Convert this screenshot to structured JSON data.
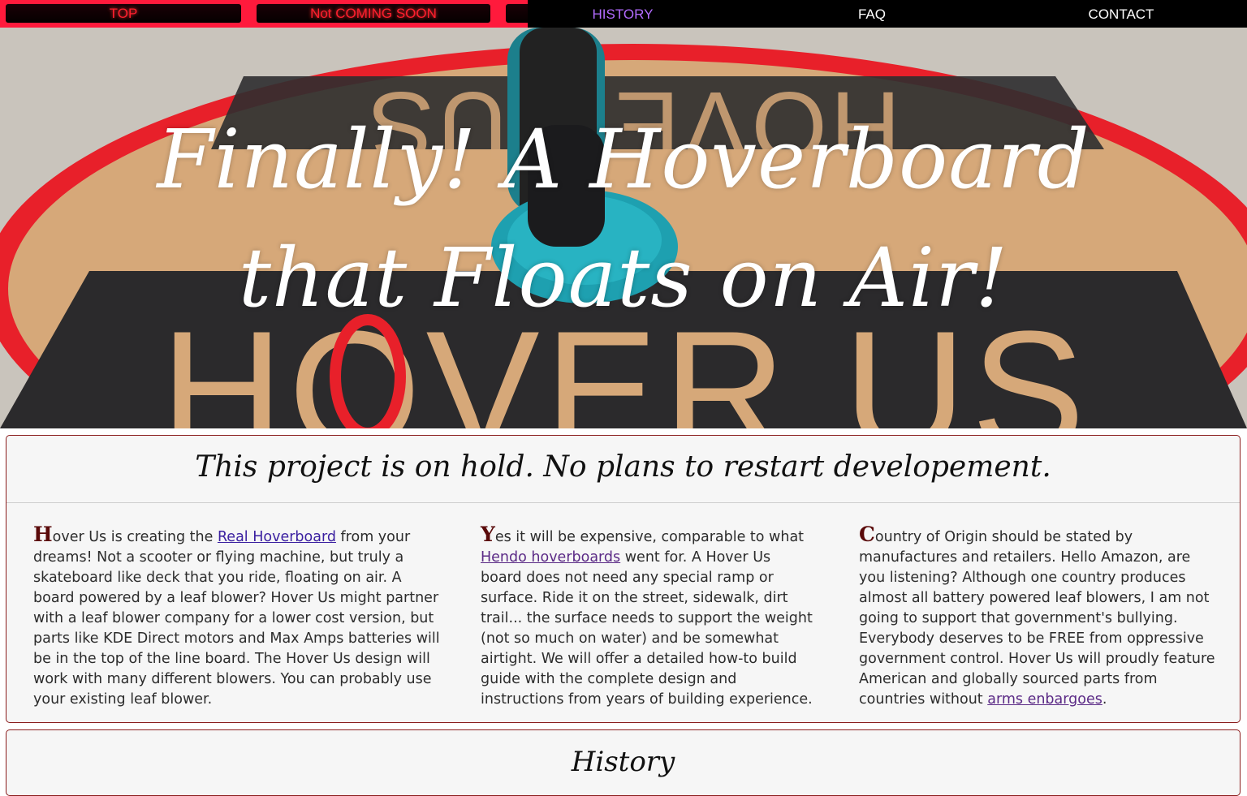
{
  "nav": {
    "items": [
      {
        "label": "TOP"
      },
      {
        "label": "Not COMING SOON"
      },
      {
        "label": ""
      },
      {
        "label": "HISTORY"
      },
      {
        "label": "FAQ"
      },
      {
        "label": "CONTACT"
      }
    ],
    "colors": {
      "left_bg": "#ff1a3c",
      "right_bg": "#000000",
      "active": "#b26bff"
    }
  },
  "hero": {
    "title_line1": "Finally!  A Hoverboard",
    "title_line2": "that Floats on Air!",
    "deck_text_bottom": "HOVER US",
    "deck_text_top": "HOVER US"
  },
  "status": {
    "heading": "This project is on hold. No plans to restart developement."
  },
  "columns": [
    {
      "dropcap": "H",
      "before_link": "over Us is creating the ",
      "link": "Real Hoverboard",
      "after_link": " from your dreams! Not a scooter or flying machine, but truly a skateboard like deck that you ride, floating on air. A board powered by a leaf blower? Hover Us might partner with a leaf blower company for a lower cost version, but parts like KDE Direct motors and Max Amps batteries will be in the top of the line board. The Hover Us design will work with many different blowers. You can probably use your existing leaf blower."
    },
    {
      "dropcap": "Y",
      "before_link": "es it will be expensive, comparable to what ",
      "link": "Hendo hoverboards",
      "after_link": " went for. A Hover Us board does not need any special ramp or surface. Ride it on the street, sidewalk, dirt trail... the surface needs to support the weight (not so much on water) and be somewhat airtight. We will offer a detailed how-to build guide with the complete design and instructions from years of building experience."
    },
    {
      "dropcap": "C",
      "before_link": "ountry of Origin should be stated by manufactures and retailers. Hello Amazon, are you listening? Although one country produces almost all battery powered leaf blowers, I am not going to support that government's bullying. Everybody deserves to be FREE from oppressive government control. Hover Us will proudly feature American and globally sourced parts from countries without ",
      "link": "arms enbargoes",
      "after_link": "."
    }
  ],
  "history": {
    "heading": "History"
  }
}
